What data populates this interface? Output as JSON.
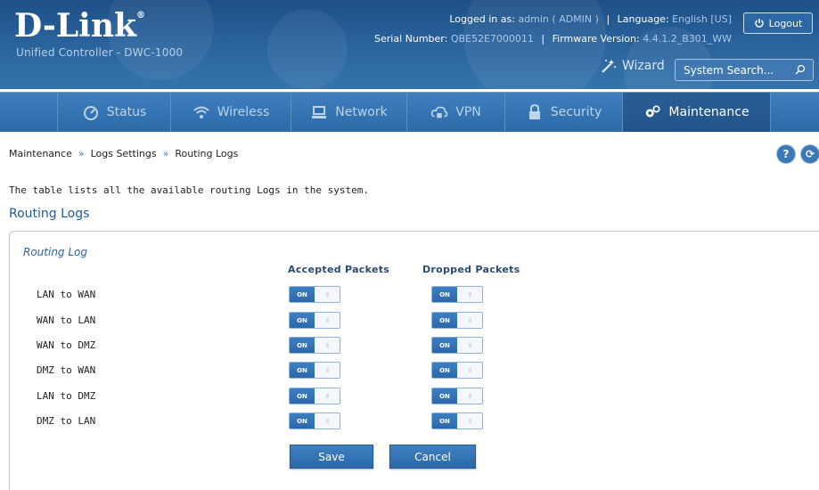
{
  "header": {
    "logo": "D-Link",
    "logo_reg": "®",
    "subtitle": "Unified Controller - DWC-1000",
    "logged_in_label": "Logged in as:",
    "logged_in_value": "admin ( ADMIN )",
    "language_label": "Language:",
    "language_value": "English [US]",
    "logout_label": "Logout",
    "serial_label": "Serial Number:",
    "serial_value": "QBE52E7000011",
    "firmware_label": "Firmware Version:",
    "firmware_value": "4.4.1.2_B301_WW",
    "wizard_label": "Wizard",
    "search_placeholder": "System Search..."
  },
  "nav": {
    "items": [
      {
        "label": "Status",
        "icon": "dashboard-icon",
        "active": false
      },
      {
        "label": "Wireless",
        "icon": "wifi-icon",
        "active": false
      },
      {
        "label": "Network",
        "icon": "monitor-icon",
        "active": false
      },
      {
        "label": "VPN",
        "icon": "cloud-lock-icon",
        "active": false
      },
      {
        "label": "Security",
        "icon": "lock-icon",
        "active": false
      },
      {
        "label": "Maintenance",
        "icon": "gears-icon",
        "active": true
      }
    ]
  },
  "breadcrumb": {
    "items": [
      "Maintenance",
      "Logs Settings",
      "Routing Logs"
    ],
    "separator": "»"
  },
  "page": {
    "description": "The table lists all the available routing Logs in the system.",
    "section_title": "Routing Logs",
    "help_label": "?",
    "refresh_label": "⟳"
  },
  "panel": {
    "title": "Routing Log",
    "columns": [
      "Accepted Packets",
      "Dropped Packets"
    ],
    "rows": [
      {
        "label": "LAN to WAN",
        "accepted": "ON",
        "dropped": "ON"
      },
      {
        "label": "WAN to LAN",
        "accepted": "ON",
        "dropped": "ON"
      },
      {
        "label": "WAN to DMZ",
        "accepted": "ON",
        "dropped": "ON"
      },
      {
        "label": "DMZ to WAN",
        "accepted": "ON",
        "dropped": "ON"
      },
      {
        "label": "LAN to DMZ",
        "accepted": "ON",
        "dropped": "ON"
      },
      {
        "label": "DMZ to LAN",
        "accepted": "ON",
        "dropped": "ON"
      }
    ],
    "toggle_knob": "III"
  },
  "actions": {
    "save_label": "Save",
    "cancel_label": "Cancel"
  },
  "colors": {
    "brand_blue": "#2b659f",
    "accent": "#3b78b6"
  }
}
